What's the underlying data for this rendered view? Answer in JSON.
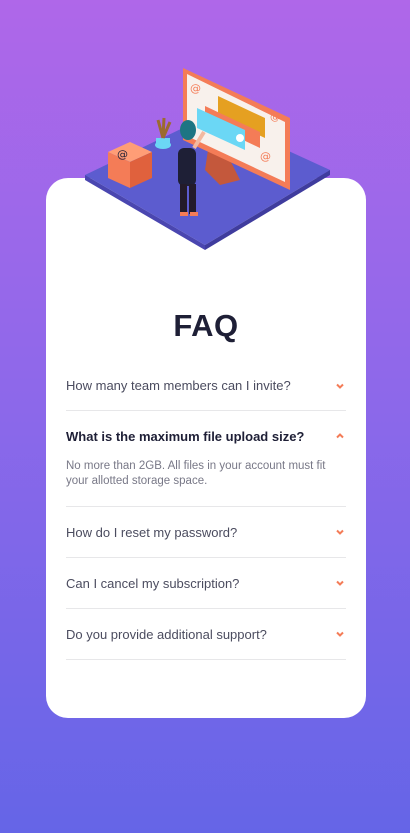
{
  "faq": {
    "title": "FAQ",
    "items": [
      {
        "question": "How many team members can I invite?",
        "open": false
      },
      {
        "question": "What is the maximum file upload size?",
        "open": true,
        "answer": "No more than 2GB. All files in your account must fit your allotted storage space."
      },
      {
        "question": "How do I reset my password?",
        "open": false
      },
      {
        "question": "Can I cancel my subscription?",
        "open": false
      },
      {
        "question": "Do you provide additional support?",
        "open": false
      }
    ]
  },
  "colors": {
    "accent": "#f47c57",
    "background_top": "#af67e9",
    "background_bottom": "#6565e7",
    "heading": "#1e1f36",
    "text": "#4b4c5f",
    "answer_text": "#787887",
    "divider": "#e7e7e9"
  },
  "icons": {
    "chevron_closed": "chevron-down-icon",
    "chevron_open": "chevron-up-icon"
  }
}
